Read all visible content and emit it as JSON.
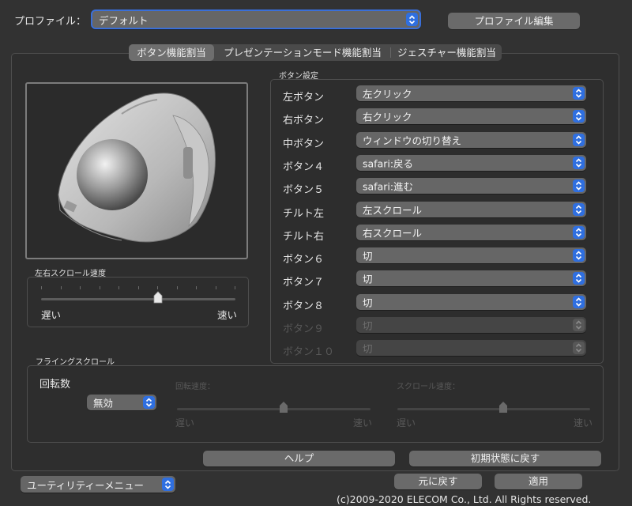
{
  "profile": {
    "label": "プロファイル：",
    "value": "デフォルト",
    "edit_button": "プロファイル編集"
  },
  "tabs": [
    {
      "label": "ボタン機能割当",
      "active": true
    },
    {
      "label": "プレゼンテーションモード機能割当",
      "active": false
    },
    {
      "label": "ジェスチャー機能割当",
      "active": false
    }
  ],
  "button_settings": {
    "title": "ボタン設定",
    "rows": [
      {
        "label": "左ボタン",
        "value": "左クリック",
        "enabled": true
      },
      {
        "label": "右ボタン",
        "value": "右クリック",
        "enabled": true
      },
      {
        "label": "中ボタン",
        "value": "ウィンドウの切り替え",
        "enabled": true
      },
      {
        "label": "ボタン４",
        "value": "safari:戻る",
        "enabled": true
      },
      {
        "label": "ボタン５",
        "value": "safari:進む",
        "enabled": true
      },
      {
        "label": "チルト左",
        "value": "左スクロール",
        "enabled": true
      },
      {
        "label": "チルト右",
        "value": "右スクロール",
        "enabled": true
      },
      {
        "label": "ボタン６",
        "value": "切",
        "enabled": true
      },
      {
        "label": "ボタン７",
        "value": "切",
        "enabled": true
      },
      {
        "label": "ボタン８",
        "value": "切",
        "enabled": true
      },
      {
        "label": "ボタン９",
        "value": "切",
        "enabled": false
      },
      {
        "label": "ボタン１０",
        "value": "切",
        "enabled": false
      }
    ]
  },
  "hscroll": {
    "title": "左右スクロール速度",
    "slow": "遅い",
    "fast": "速い",
    "value_fraction": 0.6
  },
  "flying": {
    "title": "フライングスクロール",
    "rotation_label": "回転数",
    "rotation_value": "無効",
    "rotation_speed": {
      "title": "回転速度：",
      "slow": "遅い",
      "fast": "速い",
      "value_fraction": 0.55
    },
    "scroll_speed": {
      "title": "スクロール速度：",
      "slow": "遅い",
      "fast": "速い",
      "value_fraction": 0.55
    }
  },
  "actions": {
    "help": "ヘルプ",
    "reset_default": "初期状態に戻す",
    "revert": "元に戻す",
    "apply": "適用"
  },
  "utility_menu": "ユーティリティーメニュー",
  "copyright": "(c)2009-2020 ELECOM Co., Ltd. All Rights reserved.",
  "colors": {
    "accent": "#2f6fe0",
    "background": "#323232"
  }
}
